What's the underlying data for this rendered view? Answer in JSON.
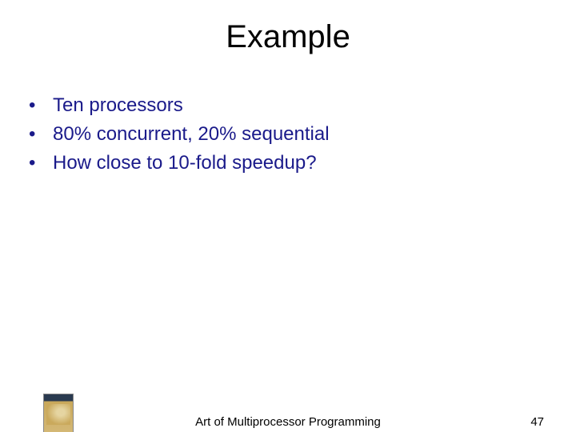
{
  "title": "Example",
  "bullets": [
    "Ten processors",
    "80% concurrent, 20% sequential",
    "How close to 10-fold speedup?"
  ],
  "footer": {
    "text": "Art of Multiprocessor Programming",
    "page": "47"
  }
}
